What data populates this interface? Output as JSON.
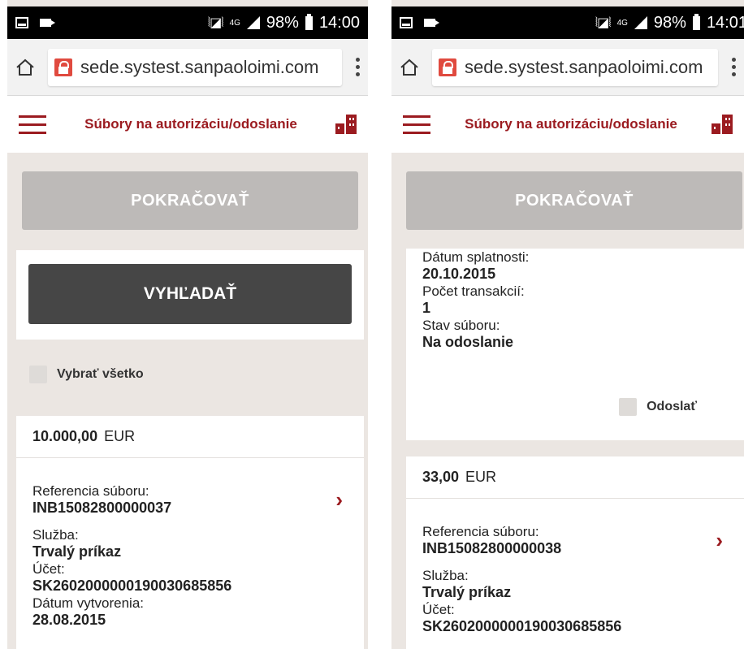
{
  "left": {
    "status": {
      "network": "4G",
      "battery": "98%",
      "time": "14:00"
    },
    "browser": {
      "url": "sede.systest.sanpaoloimi.com"
    },
    "header": {
      "title": "Súbory na autorizáciu/odoslanie"
    },
    "continue_label": "POKRAČOVAŤ",
    "search_label": "VYHĽADAŤ",
    "select_all_label": "Vybrať všetko",
    "file": {
      "amount": "10.000,00",
      "currency": "EUR",
      "ref_label": "Referencia súboru:",
      "ref_value": "INB15082800000037",
      "service_label": "Služba:",
      "service_value": "Trvalý príkaz",
      "account_label": "Účet:",
      "account_value": "SK2602000000190030685856",
      "created_label": "Dátum vytvorenia:",
      "created_value": "28.08.2015"
    }
  },
  "right": {
    "status": {
      "network": "4G",
      "battery": "98%",
      "time": "14:01"
    },
    "browser": {
      "url": "sede.systest.sanpaoloimi.com"
    },
    "header": {
      "title": "Súbory na autorizáciu/odoslanie"
    },
    "continue_label": "POKRAČOVAŤ",
    "prev_file": {
      "due_label": "Dátum splatnosti:",
      "due_value": "20.10.2015",
      "tx_label": "Počet transakcií:",
      "tx_value": "1",
      "state_label": "Stav súboru:",
      "state_value": "Na odoslanie",
      "send_label": "Odoslať"
    },
    "file": {
      "amount": "33,00",
      "currency": "EUR",
      "ref_label": "Referencia súboru:",
      "ref_value": "INB15082800000038",
      "service_label": "Služba:",
      "service_value": "Trvalý príkaz",
      "account_label": "Účet:",
      "account_value": "SK2602000000190030685856"
    }
  },
  "colors": {
    "brand": "#9b1b20",
    "background": "#ebe6e2",
    "disabled_button": "#bdbab8",
    "dark_button": "#464646"
  }
}
